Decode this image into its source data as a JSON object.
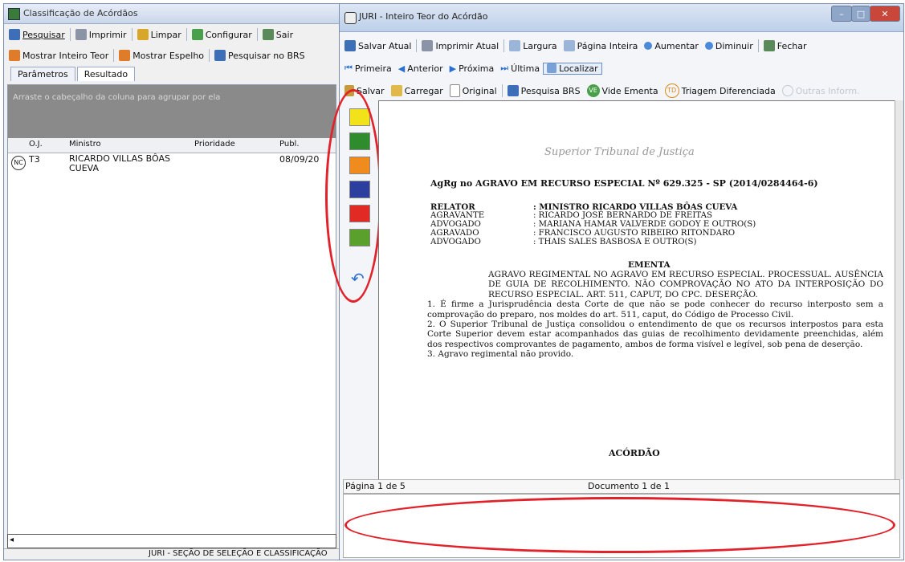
{
  "left_window": {
    "title": "Classificação de Acórdãos",
    "toolbar1": [
      "Pesquisar",
      "Imprimir",
      "Limpar",
      "Configurar",
      "Sair"
    ],
    "toolbar2": [
      "Mostrar Inteiro Teor",
      "Mostrar Espelho",
      "Pesquisar no BRS"
    ],
    "tabs": [
      "Parâmetros",
      "Resultado"
    ],
    "group_hint": "Arraste o cabeçalho da coluna para agrupar por ela",
    "columns": [
      "O.J.",
      "Ministro",
      "Prioridade",
      "Publ."
    ],
    "row": {
      "badge": "NC",
      "oj": "T3",
      "ministro": "RICARDO VILLAS BÔAS CUEVA",
      "prioridade": "",
      "publ": "08/09/20"
    },
    "status": "JURI - SEÇÃO DE SELEÇÃO E CLASSIFICAÇÃO"
  },
  "right_window": {
    "title": "JURI - Inteiro Teor do Acórdão",
    "toolbar1": [
      "Salvar Atual",
      "Imprimir Atual",
      "Largura",
      "Página Inteira",
      "Aumentar",
      "Diminuir",
      "Fechar"
    ],
    "toolbar2": [
      "Primeira",
      "Anterior",
      "Próxima",
      "Última",
      "Localizar"
    ],
    "toolbar3": [
      "Salvar",
      "Carregar",
      "Original",
      "Pesquisa BRS",
      "Vide Ementa",
      "Triagem Diferenciada",
      "Outras Inform."
    ],
    "badges": {
      "vide": "VE",
      "triagem": "TD"
    },
    "palette_colors": [
      "#f2e21a",
      "#2e8b2e",
      "#f08c1e",
      "#2c3f9e",
      "#e22a24",
      "#5aa02c"
    ],
    "status_page": "Página 1 de 5",
    "status_doc": "Documento 1 de 1"
  },
  "document": {
    "logo": "Superior Tribunal de Justiça",
    "title": "AgRg no AGRAVO EM RECURSO ESPECIAL Nº 629.325 - SP (2014/0284464-6)",
    "parties": [
      {
        "role": "RELATOR",
        "name": ": MINISTRO RICARDO VILLAS BÔAS CUEVA"
      },
      {
        "role": "AGRAVANTE",
        "name": ": RICARDO JOSÉ BERNARDO DE FREITAS"
      },
      {
        "role": "ADVOGADO",
        "name": ": MARIANA HAMAR VALVERDE GODOY E OUTRO(S)"
      },
      {
        "role": "AGRAVADO",
        "name": ": FRANCISCO AUGUSTO RIBEIRO RITONDARO"
      },
      {
        "role": "ADVOGADO",
        "name": ": THAIS SALES BASBOSA E OUTRO(S)"
      }
    ],
    "ementa_heading": "EMENTA",
    "ementa_p1": "AGRAVO REGIMENTAL NO AGRAVO EM RECURSO ESPECIAL. PROCESSUAL. AUSÊNCIA DE GUIA DE RECOLHIMENTO. NÃO COMPROVAÇÃO NO ATO DA INTERPOSIÇÃO DO RECURSO ESPECIAL. ART. 511, CAPUT, DO CPC. DESERÇÃO.",
    "ementa_p2": "1. É firme a Jurisprudência desta Corte de que não se pode conhecer do recurso interposto sem a comprovação do preparo, nos moldes do art. 511, caput, do Código de Processo Civil.",
    "ementa_p3": "2. O Superior Tribunal de Justiça consolidou o entendimento de que os recursos interpostos para esta Corte Superior devem estar acompanhados das guias de recolhimento devidamente preenchidas, além dos respectivos comprovantes de pagamento, ambos de forma visível e legível, sob pena de deserção.",
    "ementa_p4": "3. Agravo regimental não provido.",
    "acordao_heading": "ACÓRDÃO"
  }
}
